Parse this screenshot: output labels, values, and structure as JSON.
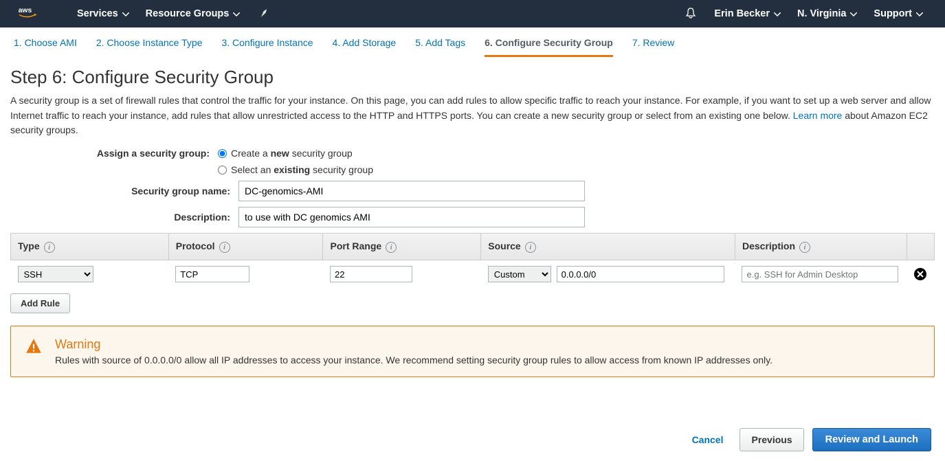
{
  "topnav": {
    "services": "Services",
    "resource_groups": "Resource Groups",
    "user": "Erin Becker",
    "region": "N. Virginia",
    "support": "Support"
  },
  "steps": [
    "1. Choose AMI",
    "2. Choose Instance Type",
    "3. Configure Instance",
    "4. Add Storage",
    "5. Add Tags",
    "6. Configure Security Group",
    "7. Review"
  ],
  "page": {
    "title": "Step 6: Configure Security Group",
    "desc_pre": "A security group is a set of firewall rules that control the traffic for your instance. On this page, you can add rules to allow specific traffic to reach your instance. For example, if you want to set up a web server and allow Internet traffic to reach your instance, add rules that allow unrestricted access to the HTTP and HTTPS ports. You can create a new security group or select from an existing one below. ",
    "learn_more": "Learn more",
    "desc_post": " about Amazon EC2 security groups."
  },
  "form": {
    "assign_label": "Assign a security group:",
    "radio_create_pre": "Create a ",
    "radio_create_bold": "new",
    "radio_create_post": " security group",
    "radio_select_pre": "Select an ",
    "radio_select_bold": "existing",
    "radio_select_post": " security group",
    "name_label": "Security group name:",
    "name_value": "DC-genomics-AMI",
    "desc_label": "Description:",
    "desc_value": "to use with DC genomics AMI"
  },
  "table": {
    "headers": {
      "type": "Type",
      "protocol": "Protocol",
      "port": "Port Range",
      "source": "Source",
      "description": "Description"
    },
    "row": {
      "type": "SSH",
      "protocol": "TCP",
      "port": "22",
      "source_select": "Custom",
      "source_cidr": "0.0.0.0/0",
      "desc_placeholder": "e.g. SSH for Admin Desktop"
    },
    "add_rule": "Add Rule"
  },
  "warning": {
    "title": "Warning",
    "text": "Rules with source of 0.0.0.0/0 allow all IP addresses to access your instance. We recommend setting security group rules to allow access from known IP addresses only."
  },
  "footer": {
    "cancel": "Cancel",
    "previous": "Previous",
    "launch": "Review and Launch"
  }
}
